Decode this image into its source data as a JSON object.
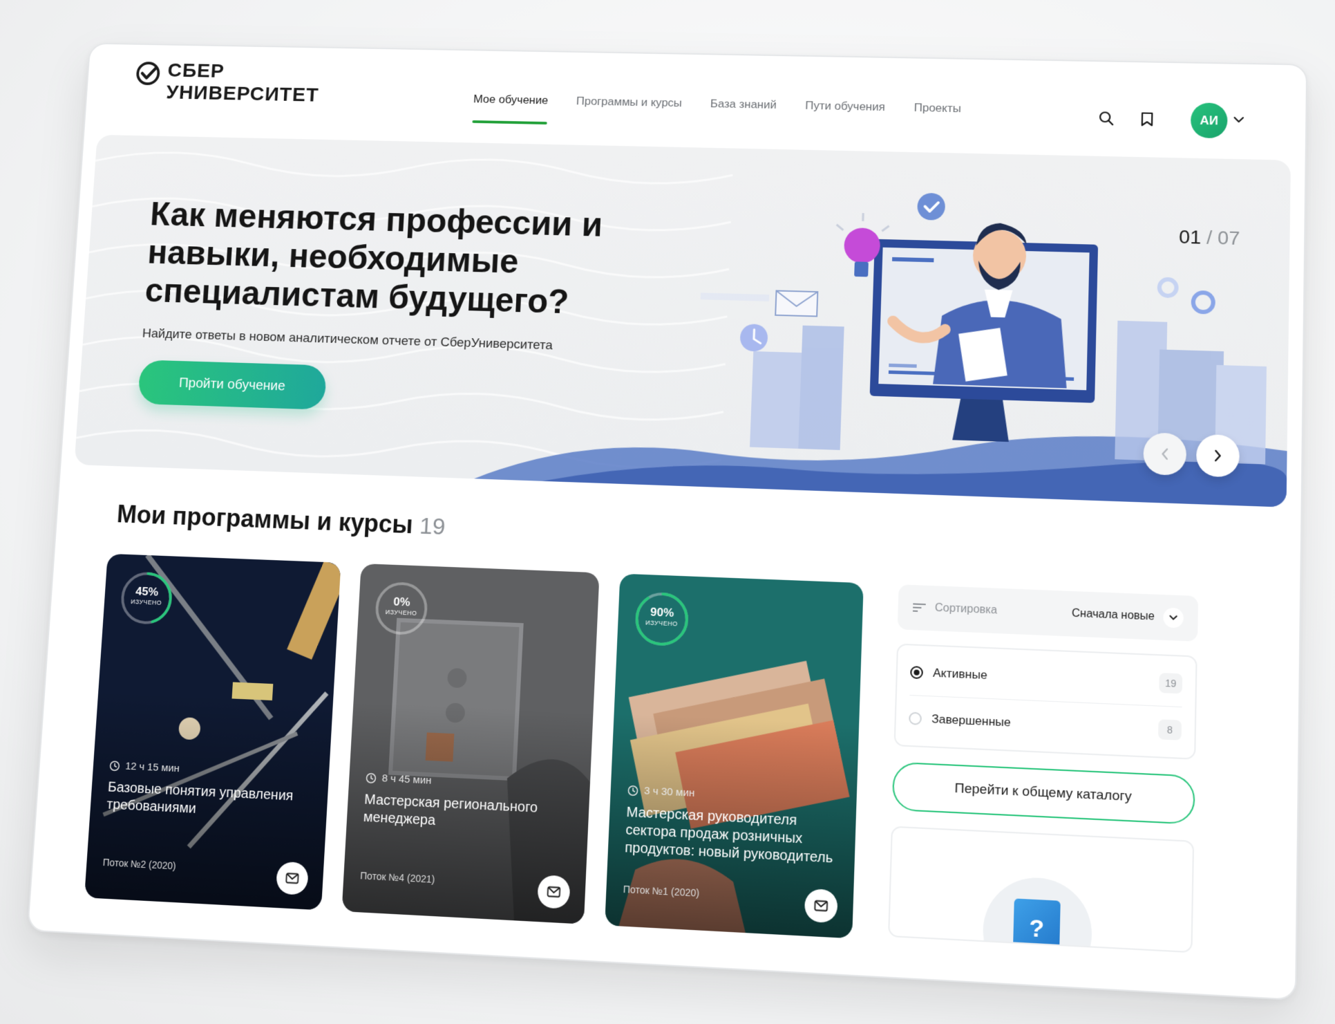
{
  "brand": {
    "line1": "СБЕР",
    "line2": "УНИВЕРСИТЕТ",
    "accent": "#21a038"
  },
  "nav": {
    "items": [
      {
        "label": "Мое обучение",
        "active": true
      },
      {
        "label": "Программы и курсы",
        "active": false
      },
      {
        "label": "База знаний",
        "active": false
      },
      {
        "label": "Пути обучения",
        "active": false
      },
      {
        "label": "Проекты",
        "active": false
      }
    ]
  },
  "header": {
    "icons": [
      "search-icon",
      "bookmark-icon"
    ],
    "avatar_initials": "АИ"
  },
  "hero": {
    "title": "Как меняются профессии и навыки, необходимые специалистам будущего?",
    "subtitle": "Найдите ответы в новом аналитическом отчете от СберУниверситета",
    "cta_label": "Пройти обучение",
    "slide_current": "01",
    "slide_separator": "/",
    "slide_total": "07"
  },
  "section": {
    "title": "Мои программы и курсы",
    "count": "19"
  },
  "courses": [
    {
      "progress_label": "45%",
      "progress": 0.45,
      "progress_caption": "изучено",
      "duration": "12 ч 15 мин",
      "title": "Базовые понятия управления требованиями",
      "stream": "Поток №2 (2020)",
      "theme": "navy"
    },
    {
      "progress_label": "0%",
      "progress": 0.0,
      "progress_caption": "изучено",
      "duration": "8 ч 45 мин",
      "title": "Мастерская регионального менеджера",
      "stream": "Поток №4 (2021)",
      "theme": "gray"
    },
    {
      "progress_label": "90%",
      "progress": 0.9,
      "progress_caption": "изучено",
      "duration": "3 ч 30 мин",
      "title": "Мастерская руководителя сектора продаж розничных продуктов: новый руководитель",
      "stream": "Поток №1 (2020)",
      "theme": "teal"
    }
  ],
  "panel": {
    "sort_label": "Сортировка",
    "sort_value": "Сначала новые",
    "filters": [
      {
        "label": "Активные",
        "count": "19",
        "selected": true
      },
      {
        "label": "Завершенные",
        "count": "8",
        "selected": false
      }
    ],
    "catalog_label": "Перейти к общему каталогу"
  },
  "colors": {
    "green": "#2ac57c",
    "teal": "#1fa89b",
    "hero_bg": "#eef0f2",
    "illustration_blue": "#4a6fc1"
  }
}
